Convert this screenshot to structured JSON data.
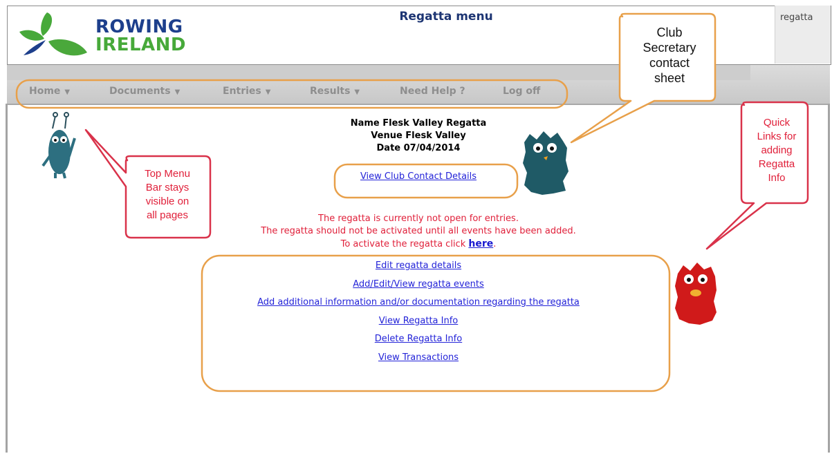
{
  "header": {
    "logo_line1": "ROWING",
    "logo_line2": "IRELAND",
    "title": "Regatta menu",
    "user": "regatta"
  },
  "nav": {
    "items": [
      {
        "label": "Home",
        "dropdown": true
      },
      {
        "label": "Documents",
        "dropdown": true
      },
      {
        "label": "Entries",
        "dropdown": true
      },
      {
        "label": "Results",
        "dropdown": true
      },
      {
        "label": "Need Help ?",
        "dropdown": false
      },
      {
        "label": "Log off",
        "dropdown": false
      }
    ]
  },
  "regatta": {
    "name_line": "Name Flesk Valley Regatta",
    "venue_line": "Venue Flesk Valley",
    "date_line": "Date 07/04/2014"
  },
  "contact_link": "View Club Contact Details",
  "warning": {
    "line1": "The regatta is currently not open for entries.",
    "line2": "The regatta should not be activated until all events have been added.",
    "line3": "To activate the regatta click",
    "here": "here",
    "period": "."
  },
  "links": [
    "Edit regatta details",
    "Add/Edit/View regatta events",
    "Add additional information and/or documentation regarding the regatta",
    "View Regatta Info",
    "Delete Regatta Info",
    "View Transactions"
  ],
  "callouts": {
    "club_secretary": [
      "Club",
      "Secretary",
      "contact",
      "sheet"
    ],
    "top_menu": [
      "Top Menu",
      "Bar stays",
      "visible on",
      "all pages"
    ],
    "quick_links": [
      "Quick",
      "Links for",
      "adding",
      "Regatta",
      "Info"
    ]
  },
  "colors": {
    "brand_blue": "#1d3f8c",
    "brand_green": "#47a93a",
    "link_blue": "#2323d8",
    "warning_red": "#e0203a",
    "highlight_orange": "#e8a04a"
  }
}
